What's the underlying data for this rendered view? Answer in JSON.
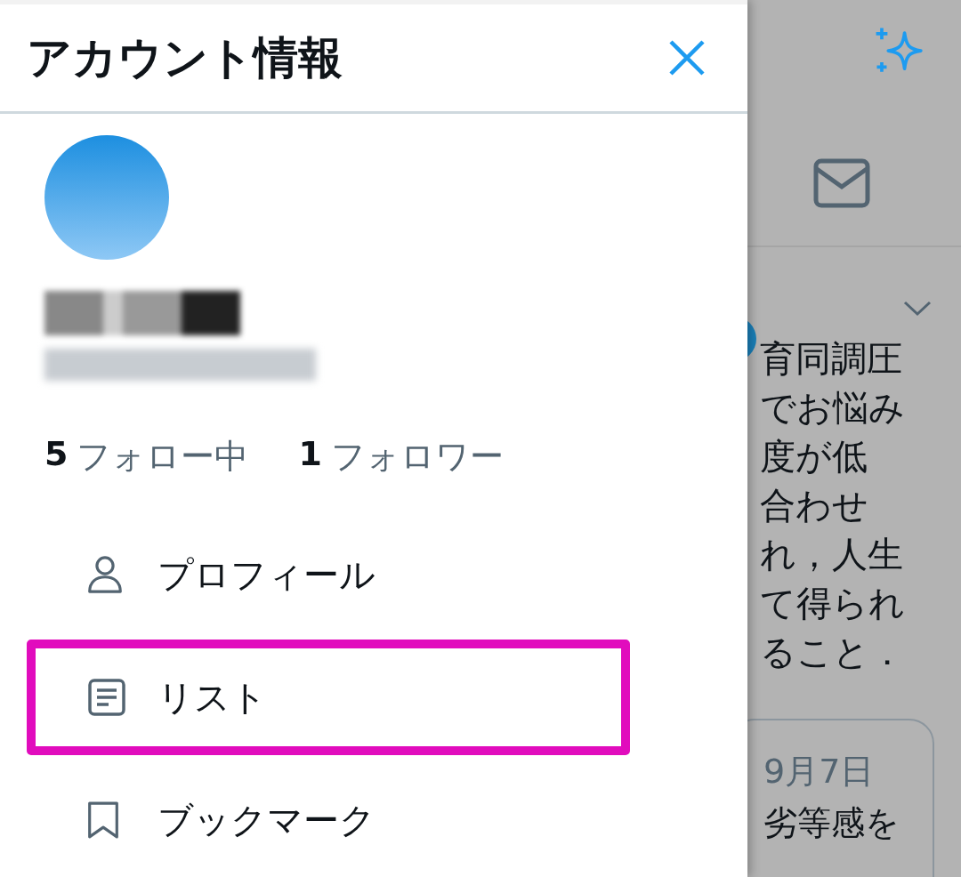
{
  "drawer": {
    "title": "アカウント情報",
    "stats": [
      {
        "count": "5",
        "label": "フォロー中"
      },
      {
        "count": "1",
        "label": "フォロワー"
      }
    ],
    "menu": [
      {
        "label": "プロフィール",
        "highlighted": false
      },
      {
        "label": "リスト",
        "highlighted": true
      },
      {
        "label": "ブックマーク",
        "highlighted": false
      }
    ]
  },
  "background": {
    "tweet_lines": [
      "育同調圧",
      "でお悩み",
      "度が低",
      "合わせ",
      "れ，人生",
      "て得られ",
      "ること．"
    ],
    "card": {
      "date": "9月7日",
      "lines": [
        "劣等感を"
      ]
    }
  }
}
